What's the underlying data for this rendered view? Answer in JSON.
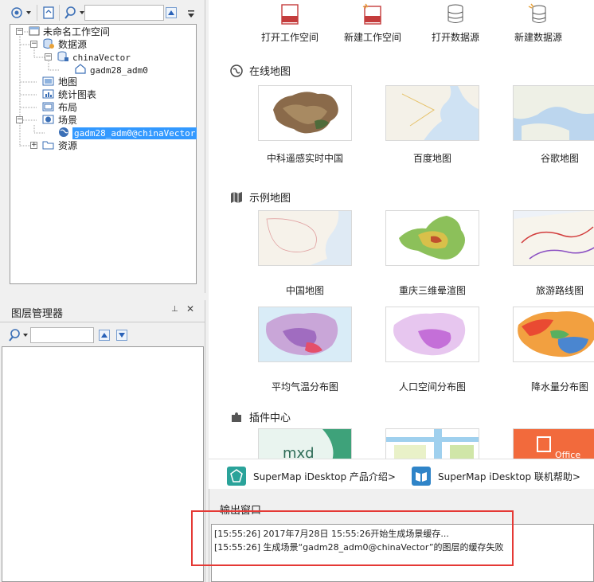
{
  "tree": {
    "workspace": "未命名工作空间",
    "datasources": "数据源",
    "datasource_name": "chinaVector",
    "dataset_name": "gadm28_adm0",
    "maps": "地图",
    "charts": "统计图表",
    "layouts": "布局",
    "scenes": "场景",
    "scene_name": "gadm28_adm0@chinaVector",
    "resources": "资源"
  },
  "layer_manager": {
    "title": "图层管理器",
    "pin_glyph": "⊥",
    "close_glyph": "✕"
  },
  "quick_actions": [
    {
      "label": "打开工作空间",
      "icon": "open-workspace-icon"
    },
    {
      "label": "新建工作空间",
      "icon": "new-workspace-icon"
    },
    {
      "label": "打开数据源",
      "icon": "open-datasource-icon"
    },
    {
      "label": "新建数据源",
      "icon": "new-datasource-icon"
    }
  ],
  "sections": {
    "online": "在线地图",
    "sample": "示例地图",
    "plugins": "插件中心"
  },
  "online_maps": [
    "中科遥感实时中国",
    "百度地图",
    "谷歌地图"
  ],
  "sample_maps_row1": [
    "中国地图",
    "重庆三维晕渲图",
    "旅游路线图"
  ],
  "sample_maps_row2": [
    "平均气温分布图",
    "人口空间分布图",
    "降水量分布图"
  ],
  "plugin_thumb_text": {
    "mxd": "mxd",
    "office": "Office"
  },
  "links": {
    "product_intro": "SuperMap iDesktop 产品介绍>",
    "online_help": "SuperMap iDesktop 联机帮助>"
  },
  "output": {
    "title": "输出窗口",
    "lines": [
      "[15:55:26] 2017年7月28日 15:55:26开始生成场景缓存...",
      "[15:55:26] 生成场景“gadm28_adm0@chinaVector”的图层的缓存失败"
    ]
  },
  "colors": {
    "accent_blue": "#2f6fd6",
    "highlight_red": "#e53935",
    "selection_blue": "#3399ff"
  }
}
